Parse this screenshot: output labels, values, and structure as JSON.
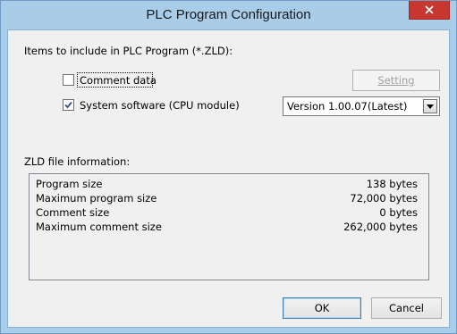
{
  "window": {
    "title": "PLC Program Configuration",
    "close_icon": "close-icon"
  },
  "items_section": {
    "label": "Items to include in PLC Program (*.ZLD):",
    "comment_data": {
      "label": "Comment data",
      "checked": false
    },
    "system_software": {
      "label": "System software (CPU module)",
      "checked": true
    },
    "setting_button": {
      "label": "Setting",
      "mnemonic": "S",
      "enabled": false
    },
    "version_select": {
      "value": "Version 1.00.07(Latest)",
      "icon": "chevron-down-icon"
    }
  },
  "zld_info": {
    "label": "ZLD file information:",
    "rows": [
      {
        "key": "Program size",
        "value": "138 bytes"
      },
      {
        "key": "Maximum program size",
        "value": "72,000 bytes"
      },
      {
        "key": "Comment size",
        "value": "0 bytes"
      },
      {
        "key": "Maximum comment size",
        "value": "262,000 bytes"
      }
    ]
  },
  "buttons": {
    "ok": "OK",
    "cancel": "Cancel"
  },
  "colors": {
    "frame": "#a9cde9",
    "close_button": "#c7372f",
    "client_bg": "#f0f0f0"
  }
}
